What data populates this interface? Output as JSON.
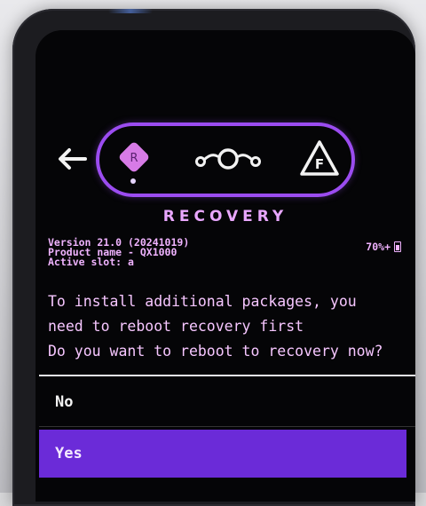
{
  "header": {
    "mode_icons": [
      "back-arrow-icon",
      "recovery-r-icon",
      "lineage-logo-icon",
      "fastboot-f-icon"
    ],
    "selected_mode_letter": "R",
    "fastboot_letter": "F",
    "title": "RECOVERY"
  },
  "device_info": {
    "version": "Version 21.0 (20241019)",
    "product": "Product name - QX1000",
    "slot": "Active slot: a",
    "battery": "70%+"
  },
  "prompt": {
    "line1": "To install additional packages, you",
    "line2": "need to reboot recovery first",
    "line3": "Do you want to reboot to recovery now?"
  },
  "menu": {
    "no_label": "No",
    "yes_label": "Yes",
    "selected": "Yes"
  },
  "colors": {
    "accent": "#9b4cf0",
    "selection": "#6b2bd8",
    "text": "#f0b3ff"
  }
}
